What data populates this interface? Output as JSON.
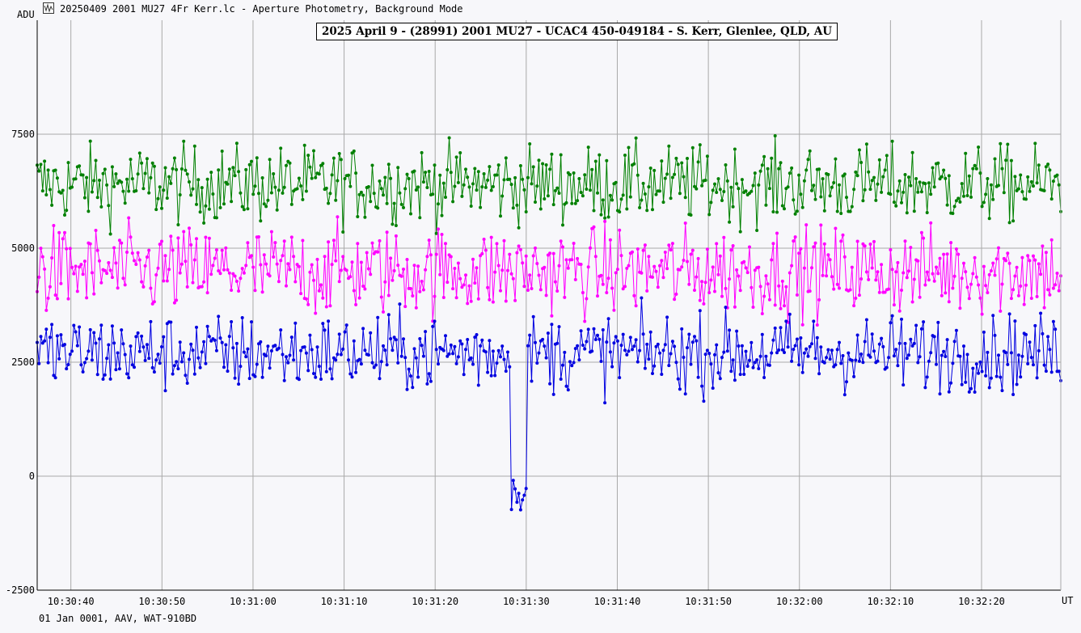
{
  "window": {
    "title": "20250409 2001 MU27 4Fr Kerr.lc - Aperture Photometry, Background Mode",
    "icon": "lightcurve-app-icon"
  },
  "footer": {
    "text": "01 Jan 0001, AAV, WAT-910BD"
  },
  "colors": {
    "green": "#008000",
    "magenta": "#ff00ff",
    "blue": "#0000e0",
    "grid": "#a9a9a9",
    "background": "#f7f7fa"
  },
  "chart_data": {
    "type": "line",
    "title": "2025 April 9 - (28991) 2001 MU27 - UCAC4 450-049184 - S. Kerr, Glenlee, QLD, AU",
    "ylabel": "ADU",
    "xlabel": "UT",
    "ylim": [
      -2500,
      10000
    ],
    "yticks": [
      -2500,
      0,
      2500,
      5000,
      7500
    ],
    "ytick_labels": [
      "-2500",
      "0",
      "2500",
      "5000",
      "7500"
    ],
    "xlim_seconds_past": [
      "10:30:36.3",
      "10:32:28.7"
    ],
    "xticks": [
      "10:30:40",
      "10:30:50",
      "10:31:00",
      "10:31:10",
      "10:31:20",
      "10:31:30",
      "10:31:40",
      "10:31:50",
      "10:32:00",
      "10:32:10",
      "10:32:20"
    ],
    "x_start": "10:30:36.3",
    "x_end": "10:32:28.7",
    "sample_count": 560,
    "series": [
      {
        "color": "#008000",
        "mean": 6400,
        "noise": 420,
        "events": []
      },
      {
        "color": "#ff00ff",
        "mean": 4500,
        "noise": 480,
        "events": []
      },
      {
        "color": "#0000e0",
        "mean": 2700,
        "noise": 420,
        "events": [
          {
            "start": "10:31:28.2",
            "end": "10:31:30.0",
            "value": -300
          }
        ]
      }
    ]
  }
}
